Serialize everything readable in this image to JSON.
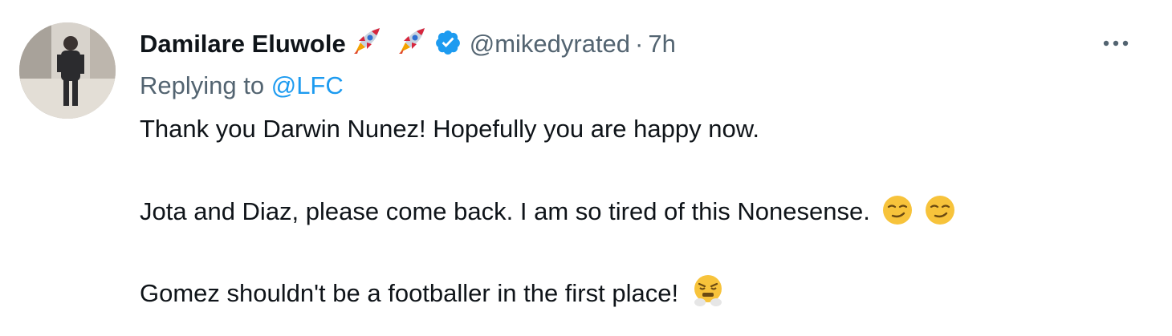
{
  "tweet": {
    "display_name": "Damilare Eluwole",
    "name_emojis": [
      "rocket-icon",
      "rocket-icon"
    ],
    "verified": true,
    "handle": "@mikedyrated",
    "separator": "·",
    "time": "7h",
    "replying_prefix": "Replying to",
    "replying_to": "@LFC",
    "lines": [
      "Thank you Darwin Nunez! Hopefully you are happy now.",
      "Jota and Diaz, please come back. I am so tired of this Nonesense.",
      "Gomez shouldn't be a footballer in the first place!"
    ],
    "line_emojis": {
      "line2": [
        "smirk-face-icon",
        "smirk-face-icon"
      ],
      "line3": [
        "steam-from-nose-face-icon"
      ]
    }
  },
  "colors": {
    "text": "#0f1419",
    "secondary": "#536471",
    "accent": "#1d9bf0",
    "emoji_yellow": "#f7c33b"
  },
  "icons": {
    "more": "more-horizontal-icon",
    "verified": "verified-badge-icon"
  }
}
